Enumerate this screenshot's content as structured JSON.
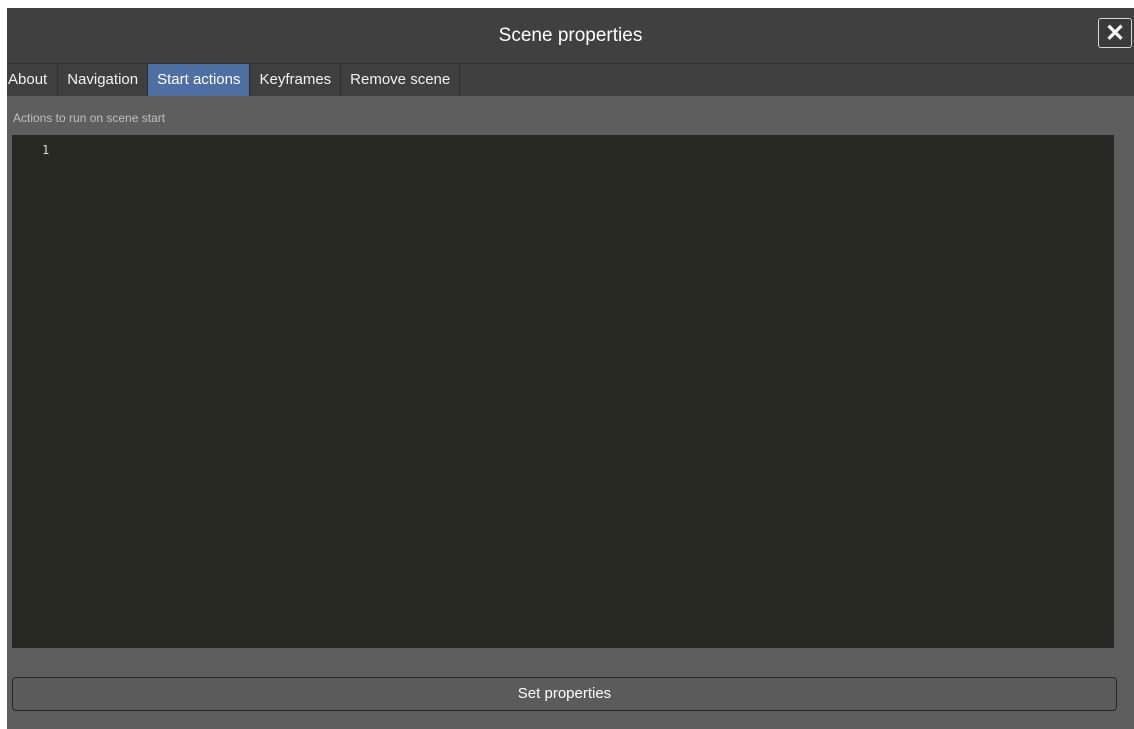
{
  "dialog": {
    "title": "Scene properties",
    "close_glyph": "✕",
    "close_icon": "close-icon"
  },
  "tabs": [
    {
      "label": "About",
      "active": false
    },
    {
      "label": "Navigation",
      "active": false
    },
    {
      "label": "Start actions",
      "active": true
    },
    {
      "label": "Keyframes",
      "active": false
    },
    {
      "label": "Remove scene",
      "active": false
    }
  ],
  "content": {
    "section_label": "Actions to run on scene start",
    "editor": {
      "line_numbers": [
        "1"
      ],
      "code": ""
    }
  },
  "footer": {
    "submit_label": "Set properties"
  },
  "colors": {
    "active_tab": "#4d6fa3",
    "editor_background": "#272822",
    "panel_background": "#5e5e5e",
    "titlebar_background": "#404040"
  }
}
